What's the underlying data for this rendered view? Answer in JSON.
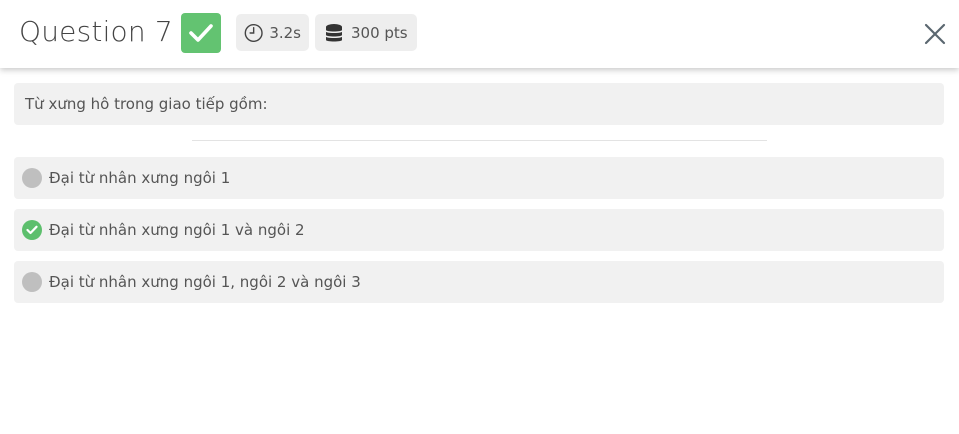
{
  "header": {
    "title": "Question 7",
    "time_label": "3.2s",
    "points_label": "300 pts"
  },
  "question": {
    "text": "Từ xưng hô trong giao tiếp gồm:"
  },
  "options": [
    {
      "label": "Đại từ nhân xưng ngôi 1",
      "state": "unselected"
    },
    {
      "label": "Đại từ nhân xưng ngôi 1 và ngôi 2",
      "state": "correct"
    },
    {
      "label": "Đại từ nhân xưng ngôi 1, ngôi 2 và ngôi 3",
      "state": "unselected"
    }
  ],
  "icons": {
    "status": "check-icon",
    "time": "clock-icon",
    "points": "coins-icon",
    "close": "close-icon"
  },
  "colors": {
    "correct": "#63c371",
    "chip_bg": "#eeeeee",
    "option_bg": "#f1f1f1",
    "unselected_dot": "#bfbfbf"
  }
}
